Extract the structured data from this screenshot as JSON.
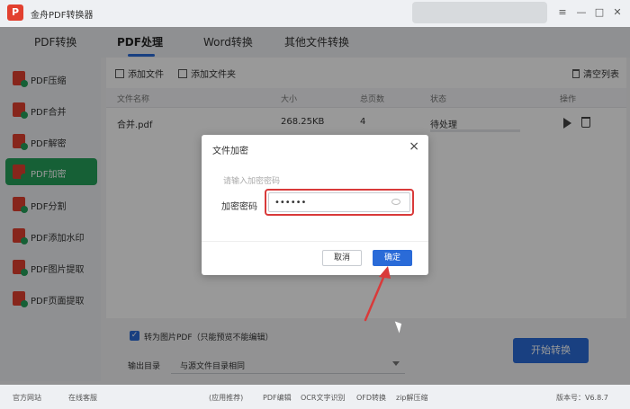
{
  "app": {
    "title": "金舟PDF转换器",
    "logo_letter": "P"
  },
  "window_controls": {
    "menu": "≡",
    "minimize": "—",
    "maximize": "□",
    "close": "✕"
  },
  "top_tabs": [
    {
      "label": "PDF转换"
    },
    {
      "label": "PDF处理"
    },
    {
      "label": "Word转换"
    },
    {
      "label": "其他文件转换"
    }
  ],
  "sidebar": {
    "items": [
      {
        "label": "PDF压缩"
      },
      {
        "label": "PDF合并"
      },
      {
        "label": "PDF解密"
      },
      {
        "label": "PDF加密"
      },
      {
        "label": "PDF分割"
      },
      {
        "label": "PDF添加水印"
      },
      {
        "label": "PDF图片提取"
      },
      {
        "label": "PDF页面提取"
      }
    ]
  },
  "toolbar": {
    "add_file": "添加文件",
    "add_folder": "添加文件夹",
    "clear_list": "清空列表"
  },
  "table": {
    "headers": {
      "name": "文件名称",
      "size": "大小",
      "pages": "总页数",
      "status": "状态",
      "action": "操作"
    },
    "rows": [
      {
        "name": "合并.pdf",
        "size": "268.25KB",
        "pages": "4",
        "status": "待处理",
        "progress": 0
      }
    ]
  },
  "bottom": {
    "checkbox_label": "转为图片PDF（只能预览不能编辑）",
    "output_label": "输出目录",
    "output_value": "与源文件目录相同",
    "start_button": "开始转换"
  },
  "statusbar": {
    "website": "官方网站",
    "support": "在线客服",
    "recommend": "(应用推荐)",
    "pdf_edit": "PDF编辑",
    "ocr": "OCR文字识别",
    "ofd": "OFD转换",
    "zip": "zip解压缩",
    "version": "版本号：V6.8.7"
  },
  "dialog": {
    "title": "文件加密",
    "hint": "请输入加密密码",
    "field_label": "加密密码",
    "password_value": "••••••",
    "cancel": "取消",
    "confirm": "确定"
  },
  "colors": {
    "accent": "#2a6bd8",
    "sidebar_active": "#26a05a",
    "highlight": "#d93a3a",
    "logo": "#e2402f"
  }
}
